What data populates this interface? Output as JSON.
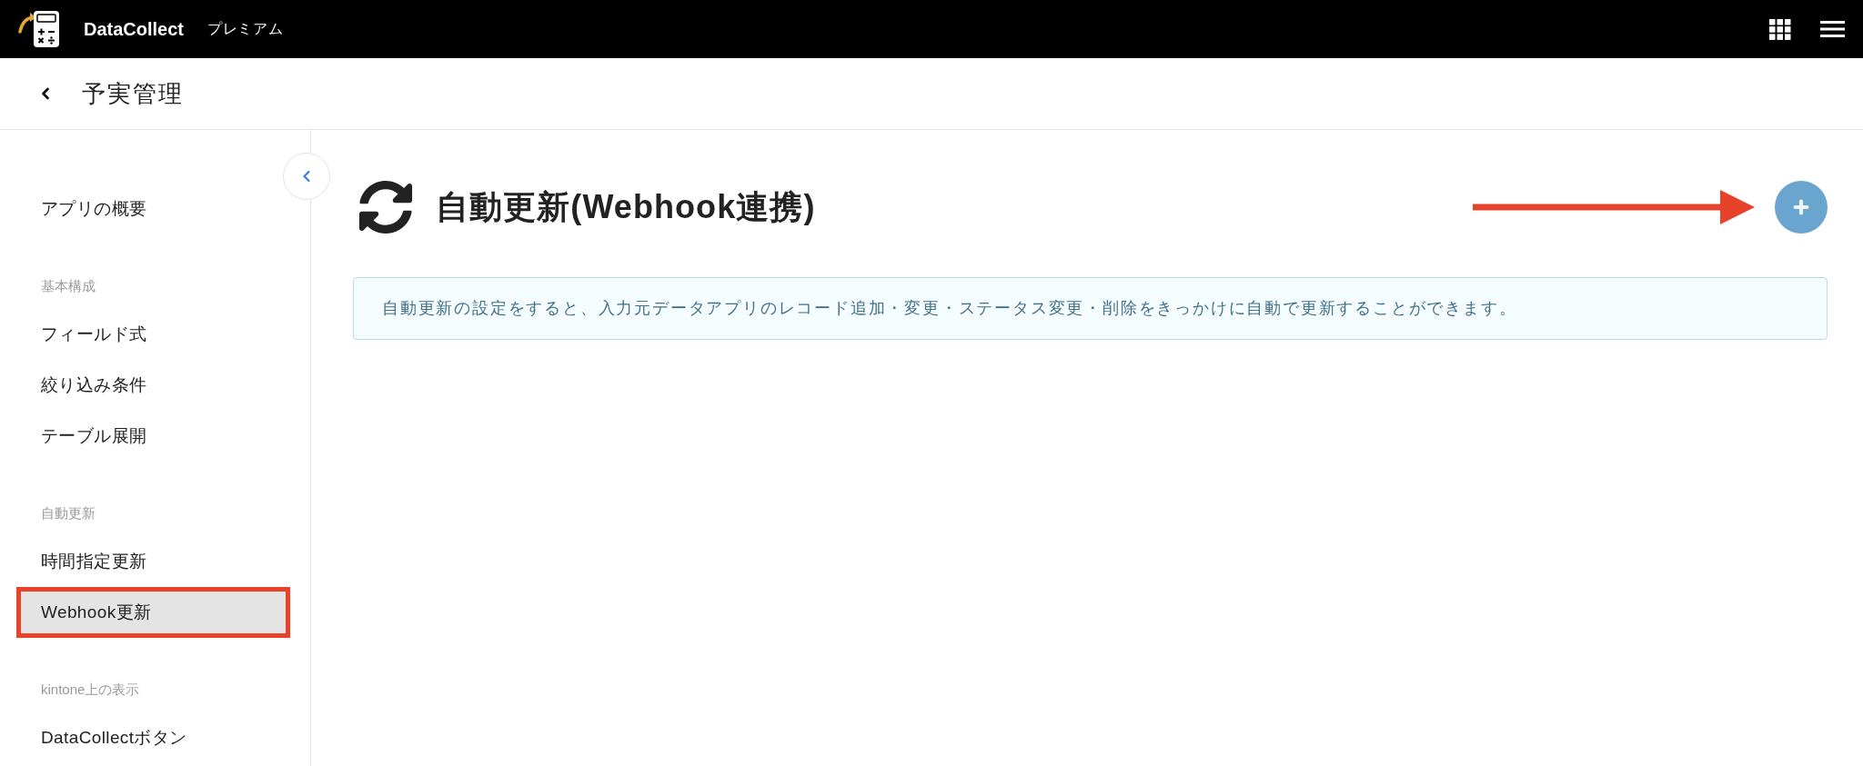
{
  "top_bar": {
    "brand": "DataCollect",
    "plan": "プレミアム"
  },
  "page_header": {
    "title": "予実管理"
  },
  "sidebar": {
    "sections": [
      {
        "items": [
          {
            "label": "アプリの概要",
            "selected": false
          }
        ]
      },
      {
        "heading": "基本構成",
        "items": [
          {
            "label": "フィールド式",
            "selected": false
          },
          {
            "label": "絞り込み条件",
            "selected": false
          },
          {
            "label": "テーブル展開",
            "selected": false
          }
        ]
      },
      {
        "heading": "自動更新",
        "items": [
          {
            "label": "時間指定更新",
            "selected": false
          },
          {
            "label": "Webhook更新",
            "selected": true
          }
        ]
      },
      {
        "heading": "kintone上の表示",
        "items": [
          {
            "label": "DataCollectボタン",
            "selected": false
          }
        ]
      }
    ]
  },
  "main": {
    "title": "自動更新(Webhook連携)",
    "notice": "自動更新の設定をすると、入力元データアプリのレコード追加・変更・ステータス変更・削除をきっかけに自動で更新することができます。"
  }
}
